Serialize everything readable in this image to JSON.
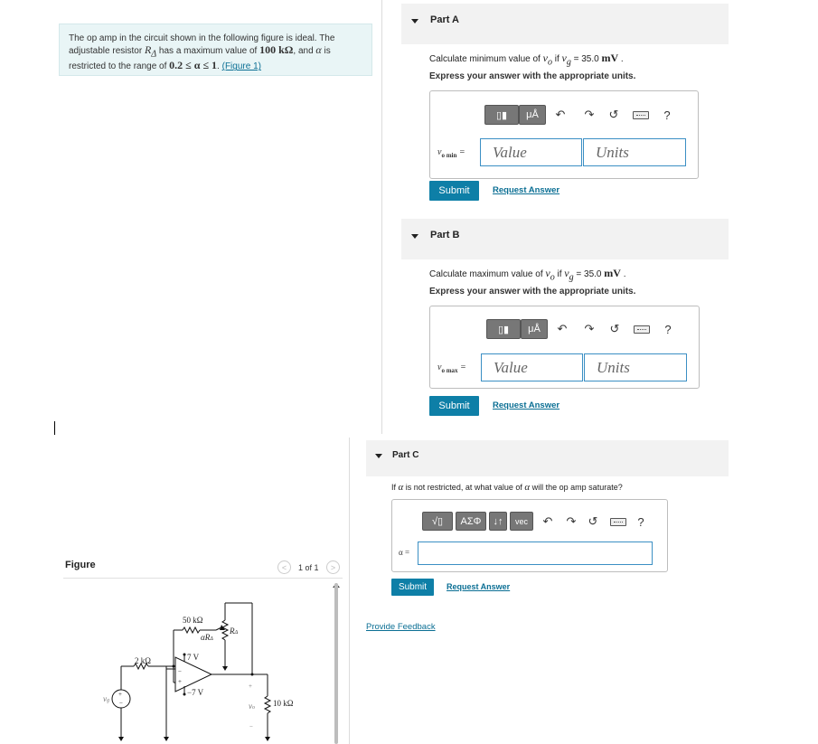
{
  "problem": {
    "text1": "The op amp in the circuit shown in the following figure is ideal. The adjustable resistor ",
    "ra": "R",
    "ra_sub": "Δ",
    "text2": " has a maximum value of ",
    "maxval": "100 kΩ",
    "text3": ", and ",
    "alpha": "α",
    "text4": " is restricted to the range of ",
    "range": "0.2 ≤ α ≤ 1",
    "text5": ". ",
    "figure_link": "(Figure 1)"
  },
  "toolbar": {
    "templates_label": "▯▮",
    "units_label": "μÅ",
    "math_label": "√▯",
    "greek_label": "ΑΣΦ",
    "arrows_label": "↓↑",
    "vec_label": "vec",
    "undo_icon": "↶",
    "redo_icon": "↷",
    "reset_icon": "↺",
    "help_label": "?"
  },
  "partA": {
    "title": "Part A",
    "q1": "Calculate minimum value of ",
    "vo": "v",
    "vo_sub": "o",
    "q2": " if ",
    "vg": "v",
    "vg_sub": "g",
    "q3": " = 35.0 ",
    "unit": "mV",
    "q4": " .",
    "instruction": "Express your answer with the appropriate units.",
    "var_main": "v",
    "var_sub": "o min",
    "var_eq": " =",
    "value_placeholder": "Value",
    "units_placeholder": "Units",
    "submit": "Submit",
    "request": "Request Answer"
  },
  "partB": {
    "title": "Part B",
    "q1": "Calculate maximum value of ",
    "vo": "v",
    "vo_sub": "o",
    "q2": " if ",
    "vg": "v",
    "vg_sub": "g",
    "q3": " = 35.0 ",
    "unit": "mV",
    "q4": " .",
    "instruction": "Express your answer with the appropriate units.",
    "var_main": "v",
    "var_sub": "o max",
    "var_eq": " =",
    "value_placeholder": "Value",
    "units_placeholder": "Units",
    "submit": "Submit",
    "request": "Request Answer"
  },
  "partC": {
    "title": "Part C",
    "q1": "If ",
    "alpha": "α",
    "q2": " is not restricted, at what value of ",
    "alpha2": "α",
    "q3": " will the op amp saturate?",
    "var_label": "α =",
    "submit": "Submit",
    "request": "Request Answer"
  },
  "feedback": "Provide Feedback",
  "figure": {
    "title": "Figure",
    "pager": "1 of 1",
    "prev": "<",
    "next": ">",
    "labels": {
      "r50k": "50 kΩ",
      "alphaRa": "αR",
      "alphaRa_sub": "Δ",
      "ra": "R",
      "ra_sub": "Δ",
      "pos7": "7 V",
      "neg7": "−7 V",
      "r2k": "2 kΩ",
      "vg": "v",
      "vg_sub": "g",
      "vo": "v",
      "vo_sub": "o",
      "r10k": "10 kΩ",
      "plus": "+",
      "minus": "−"
    }
  },
  "colors": {
    "accent": "#0e7fa7",
    "link": "#0b6f94",
    "problem_bg": "#e9f5f6",
    "input_border": "#3b8fc4"
  }
}
